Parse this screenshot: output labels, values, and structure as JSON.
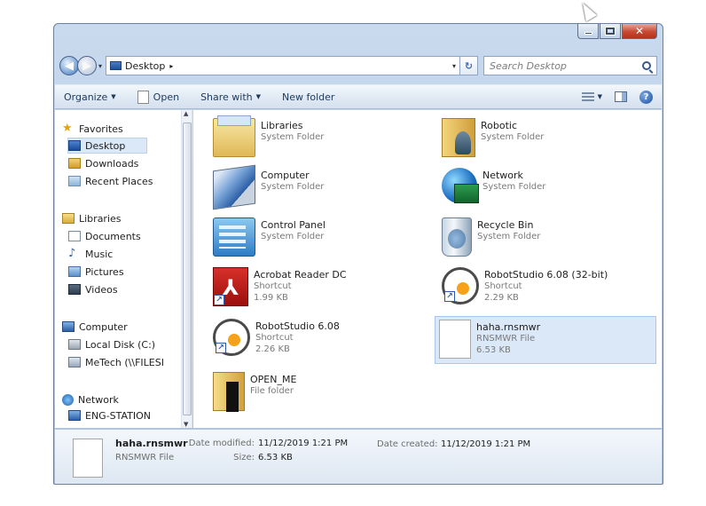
{
  "window": {
    "caption": {
      "minimize": "–",
      "maximize": "□",
      "close": "✕"
    }
  },
  "address": {
    "location": "Desktop",
    "separator": "▸",
    "dropdown": "▾",
    "refresh": "↻",
    "search_placeholder": "Search Desktop"
  },
  "toolbar": {
    "organize": "Organize",
    "open": "Open",
    "share_with": "Share with",
    "new_folder": "New folder",
    "dropdown_arrow": "▼",
    "help": "?"
  },
  "nav": {
    "favorites": "Favorites",
    "desktop": "Desktop",
    "downloads": "Downloads",
    "recent_places": "Recent Places",
    "libraries": "Libraries",
    "documents": "Documents",
    "music": "Music",
    "pictures": "Pictures",
    "videos": "Videos",
    "computer": "Computer",
    "local_disk": "Local Disk (C:)",
    "metech": "MeTech (\\\\FILESI",
    "network": "Network",
    "eng_station": "ENG-STATION"
  },
  "items": [
    {
      "name": "Libraries",
      "sub1": "System Folder",
      "sub2": ""
    },
    {
      "name": "Robotic",
      "sub1": "System Folder",
      "sub2": ""
    },
    {
      "name": "Computer",
      "sub1": "System Folder",
      "sub2": ""
    },
    {
      "name": "Network",
      "sub1": "System Folder",
      "sub2": ""
    },
    {
      "name": "Control Panel",
      "sub1": "System Folder",
      "sub2": ""
    },
    {
      "name": "Recycle Bin",
      "sub1": "System Folder",
      "sub2": ""
    },
    {
      "name": "Acrobat Reader DC",
      "sub1": "Shortcut",
      "sub2": "1.99 KB"
    },
    {
      "name": "RobotStudio 6.08 (32-bit)",
      "sub1": "Shortcut",
      "sub2": "2.29 KB"
    },
    {
      "name": "RobotStudio 6.08",
      "sub1": "Shortcut",
      "sub2": "2.26 KB"
    },
    {
      "name": "haha.rnsmwr",
      "sub1": "RNSMWR File",
      "sub2": "6.53 KB"
    },
    {
      "name": "OPEN_ME",
      "sub1": "File folder",
      "sub2": ""
    }
  ],
  "details": {
    "name": "haha.rnsmwr",
    "type": "RNSMWR File",
    "modified_label": "Date modified:",
    "modified_value": "11/12/2019 1:21 PM",
    "size_label": "Size:",
    "size_value": "6.53 KB",
    "created_label": "Date created:",
    "created_value": "11/12/2019 1:21 PM"
  },
  "icons": {
    "shortcut_arrow": "↗",
    "star": "★",
    "music_note": "♪"
  }
}
